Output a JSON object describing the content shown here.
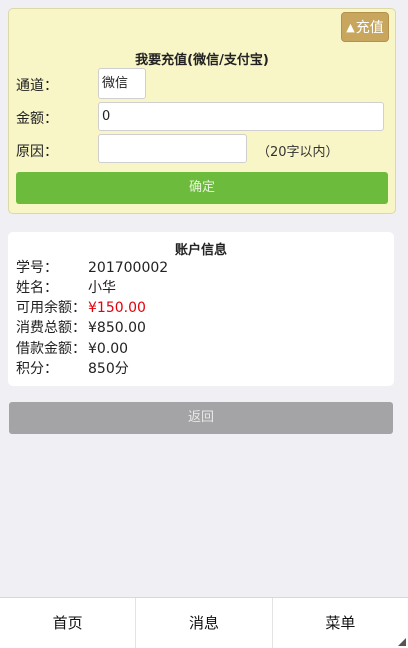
{
  "recharge": {
    "toggle_label": "充值",
    "toggle_icon": "triangle-up-icon",
    "title": "我要充值(微信/支付宝)",
    "channel_label": "通道：",
    "channel_value": "微信",
    "amount_label": "金额：",
    "amount_value": "0",
    "reason_label": "原因：",
    "reason_value": "",
    "reason_hint": "（20字以内）",
    "confirm_label": "确定"
  },
  "account": {
    "title": "账户信息",
    "rows": [
      {
        "key": "学号：",
        "value": "201700002"
      },
      {
        "key": "姓名：",
        "value": "小华"
      },
      {
        "key": "可用余额：",
        "value": "¥150.00"
      },
      {
        "key": "消费总额：",
        "value": "¥850.00"
      },
      {
        "key": "借款金额：",
        "value": "¥0.00"
      },
      {
        "key": "积分：",
        "value": "850分"
      }
    ]
  },
  "back_label": "返回",
  "nav": {
    "items": [
      "首页",
      "消息",
      "菜单"
    ]
  },
  "colors": {
    "panel_bg": "#f8f5c7",
    "toggle_bg": "#c9a65e",
    "confirm_bg": "#6cbb3c",
    "back_bg": "#a4a4a6",
    "highlight_red": "#e3000b"
  }
}
